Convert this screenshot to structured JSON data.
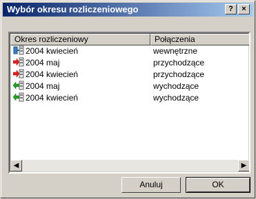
{
  "window": {
    "title": "Wybór okresu rozliczeniowego",
    "help_label": "?",
    "close_label": "×"
  },
  "listview": {
    "columns": [
      "Okres rozliczeniowy",
      "Połączenia"
    ],
    "rows": [
      {
        "period": "2004 kwiecień",
        "type": "wewnętrzne",
        "icon": "internal-calls-icon"
      },
      {
        "period": "2004 maj",
        "type": "przychodzące",
        "icon": "incoming-calls-icon"
      },
      {
        "period": "2004 kwiecień",
        "type": "przychodzące",
        "icon": "incoming-calls-icon"
      },
      {
        "period": "2004 maj",
        "type": "wychodzące",
        "icon": "outgoing-calls-icon"
      },
      {
        "period": "2004 kwiecień",
        "type": "wychodzące",
        "icon": "outgoing-calls-icon"
      }
    ],
    "scroll_left": "◀",
    "scroll_right": "▶"
  },
  "buttons": {
    "cancel": "Anuluj",
    "ok": "OK"
  },
  "colors": {
    "title_start": "#0a246a",
    "title_end": "#a6caf0",
    "face": "#d4d0c8",
    "incoming_arrow": "#e02020",
    "outgoing_arrow": "#20a020",
    "internal_icon": "#3b7fc4"
  }
}
